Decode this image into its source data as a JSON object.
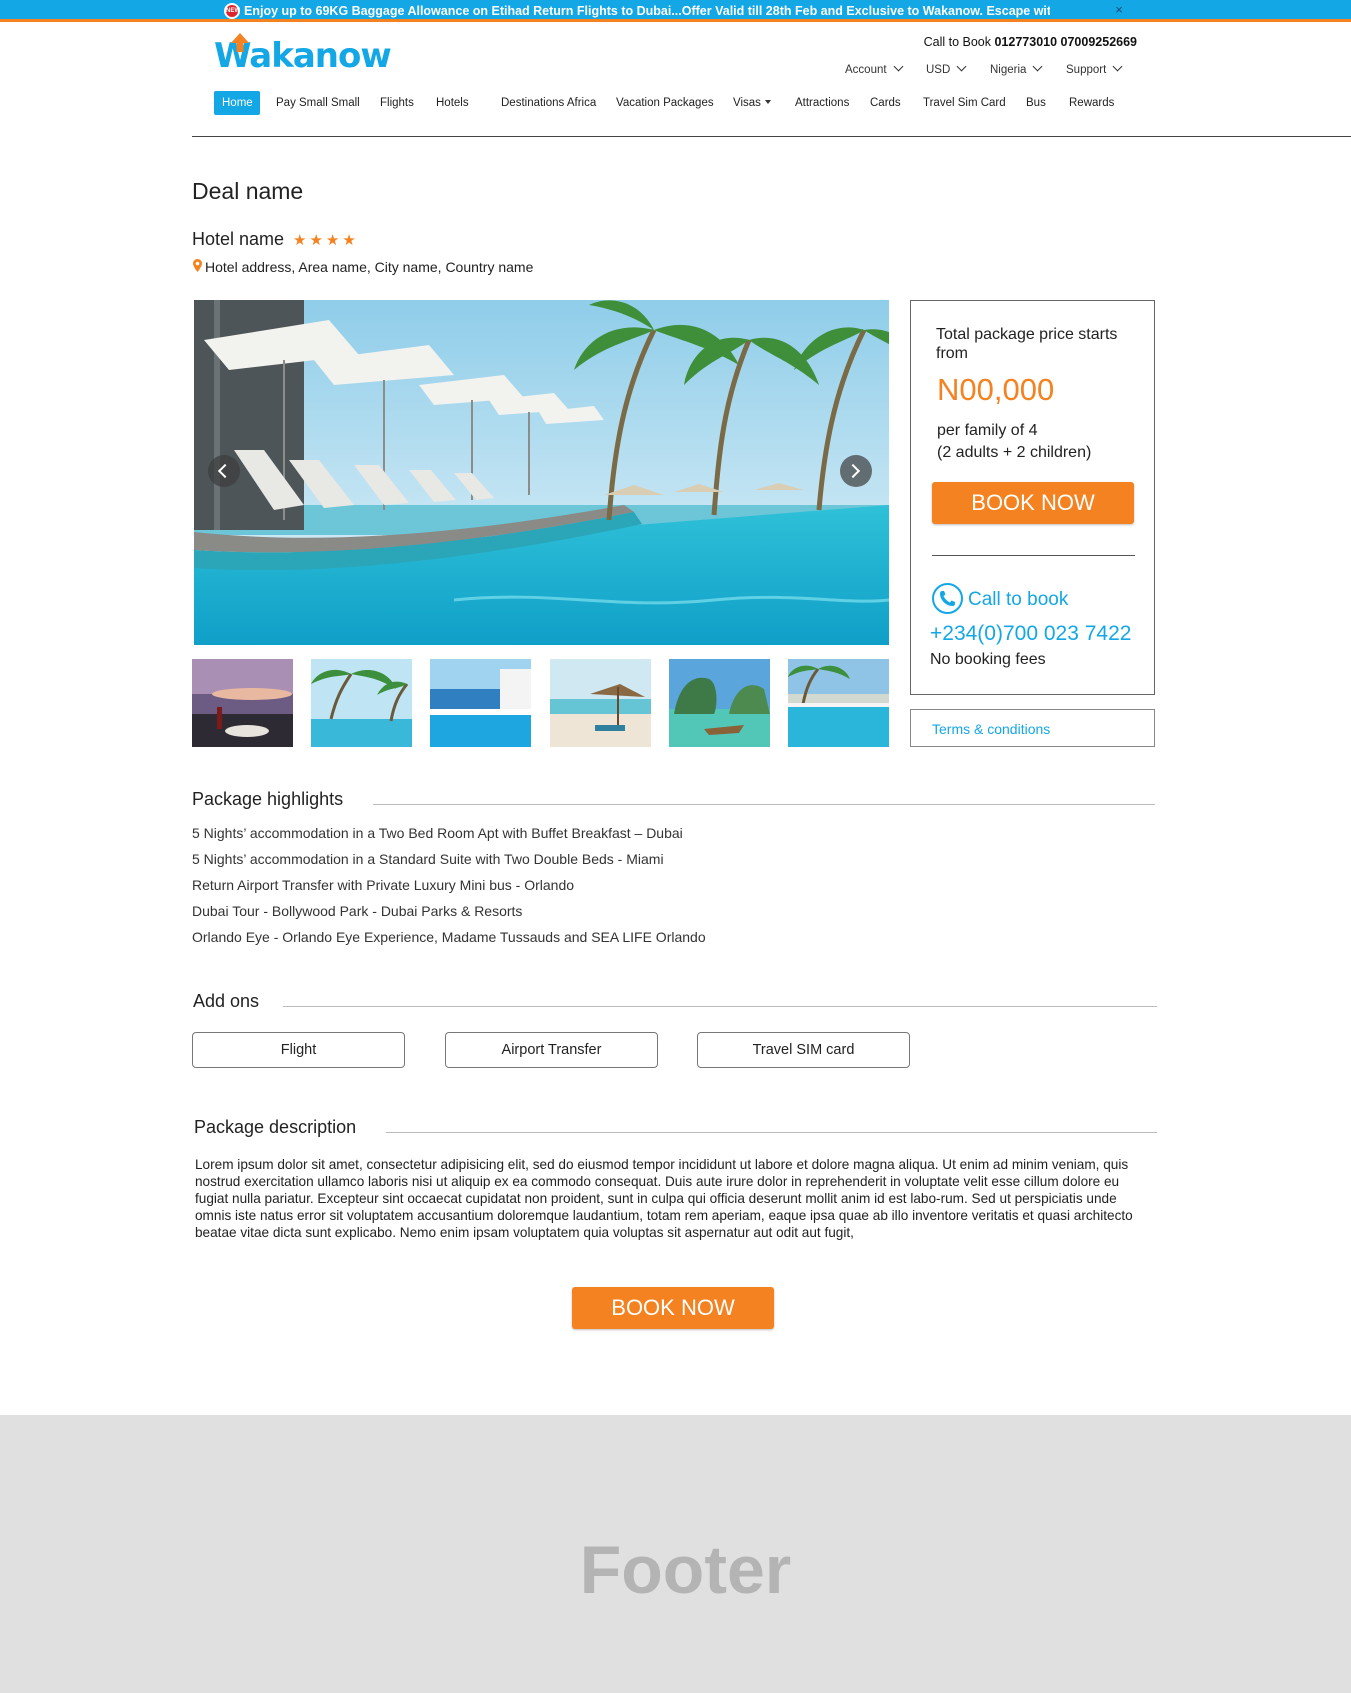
{
  "promo": {
    "badge": "NEW",
    "text": "Enjoy up to 69KG Baggage Allowance on Etihad Return Flights to Dubai...Offer Valid till 28th Feb and Exclusive to Wakanow.          Escape witl",
    "close": "×"
  },
  "header": {
    "logo": "Wakanow",
    "call_label": "Call to Book ",
    "call_numbers": "012773010 07009252669",
    "util_menu": [
      "Account",
      "USD",
      "Nigeria",
      "Support"
    ],
    "nav": [
      "Home",
      "Pay Small Small",
      "Flights",
      "Hotels",
      "Destinations Africa",
      "Vacation Packages",
      "Visas",
      "Attractions",
      "Cards",
      "Travel Sim Card",
      "Bus",
      "Rewards"
    ]
  },
  "deal": {
    "title": "Deal name",
    "hotel_name": "Hotel name",
    "stars": "★★★★",
    "address": "Hotel address, Area name, City name, Country name"
  },
  "price_box": {
    "label": "Total package price starts from",
    "price": "N00,000",
    "per_family_line1": "per family of 4",
    "per_family_line2": "(2 adults + 2 children)",
    "book_label": "BOOK NOW",
    "call_label": "Call to book",
    "phone": "+234(0)700 023 7422",
    "fees_note": "No booking fees",
    "terms": "Terms & conditions"
  },
  "highlights": {
    "title": "Package highlights",
    "items": [
      "5 Nights’ accommodation in a Two Bed Room Apt with Buffet Breakfast – Dubai",
      "5 Nights’ accommodation in a Standard Suite with Two Double Beds - Miami",
      "Return Airport Transfer with Private Luxury Mini bus - Orlando",
      "Dubai Tour - Bollywood Park - Dubai Parks & Resorts",
      "Orlando Eye - Orlando Eye Experience, Madame Tussauds and SEA LIFE Orlando"
    ]
  },
  "addons": {
    "title": "Add ons",
    "items": [
      "Flight",
      "Airport Transfer",
      "Travel SIM card"
    ]
  },
  "description": {
    "title": "Package description",
    "text": "Lorem ipsum dolor sit amet, consectetur adipisicing elit, sed do eiusmod tempor incididunt ut labore et dolore magna aliqua. Ut enim ad minim veniam, quis nostrud exercitation ullamco laboris nisi ut aliquip ex ea commodo consequat. Duis aute irure dolor in reprehenderit in voluptate velit esse cillum dolore eu fugiat nulla pariatur. Excepteur sint occaecat cupidatat non proident, sunt in culpa qui officia deserunt mollit anim id est labo-rum. Sed ut perspiciatis unde omnis iste natus error sit voluptatem accusantium doloremque laudantium, totam rem aperiam, eaque ipsa quae ab illo inventore veritatis et quasi architecto beatae vitae dicta sunt explicabo. Nemo enim ipsam voluptatem quia voluptas sit aspernatur aut odit aut fugit,"
  },
  "bottom_book_label": "BOOK NOW",
  "footer": {
    "text": "Footer"
  },
  "colors": {
    "brand_blue": "#13a7e6",
    "accent_orange": "#f58220",
    "footer_bg": "#e0e0e0"
  }
}
